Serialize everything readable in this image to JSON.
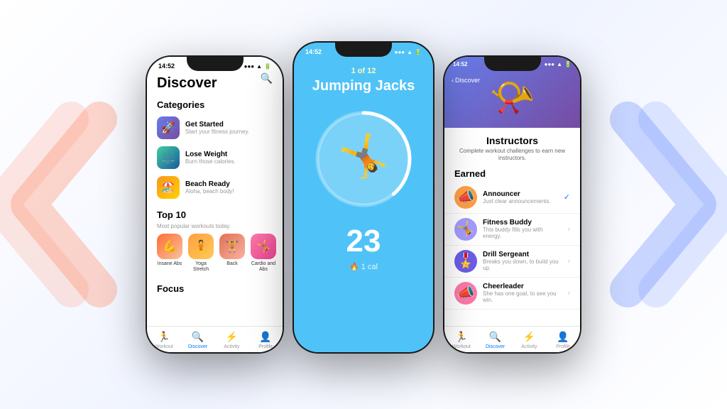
{
  "background": {
    "color": "#f5f5f7"
  },
  "left_phone": {
    "status_bar": {
      "time": "14:52",
      "signal": "●●●",
      "wifi": "wifi",
      "battery": "🔋"
    },
    "title": "Discover",
    "categories_title": "Categories",
    "categories": [
      {
        "icon": "🚀",
        "name": "Get Started",
        "sub": "Start your fitness journey.",
        "style": "rocket"
      },
      {
        "icon": "⚖️",
        "name": "Lose Weight",
        "sub": "Burn those calories.",
        "style": "weight"
      },
      {
        "icon": "🏖️",
        "name": "Beach Ready",
        "sub": "Aloha, beach body!",
        "style": "beach"
      }
    ],
    "top10_title": "Top 10",
    "top10_subtitle": "Most popular workouts today.",
    "workouts": [
      {
        "icon": "💪",
        "label": "Insane Abs"
      },
      {
        "icon": "🧘",
        "label": "Yoga Stretch"
      },
      {
        "icon": "🏋️",
        "label": "Back"
      },
      {
        "icon": "🤸",
        "label": "Cardio and Abs"
      }
    ],
    "focus_title": "Focus",
    "tabs": [
      {
        "icon": "🏃",
        "label": "Workout",
        "active": false
      },
      {
        "icon": "🔍",
        "label": "Discover",
        "active": true
      },
      {
        "icon": "⚡",
        "label": "Activity",
        "active": false
      },
      {
        "icon": "👤",
        "label": "Profile",
        "active": false
      }
    ]
  },
  "center_phone": {
    "status": {
      "left": "14:52",
      "right": "●●● ▲ 🔋"
    },
    "counter": "1 of 12",
    "exercise_name": "Jumping Jacks",
    "number": "23",
    "cal": "1 cal"
  },
  "right_phone": {
    "status_bar": {
      "time": "14:52",
      "icons": "●●● ▲ 🔋"
    },
    "back_label": "Discover",
    "header_emoji": "🎺",
    "title": "Instructors",
    "subtitle": "Complete workout challenges to earn new\ninstructors.",
    "earned_title": "Earned",
    "instructors": [
      {
        "emoji": "📣",
        "name": "Announcer",
        "desc": "Just clear announcements.",
        "action": "check",
        "bg": "#ff9f43"
      },
      {
        "emoji": "🤸",
        "name": "Fitness Buddy",
        "desc": "This buddy fills you with energy.",
        "action": "chevron",
        "bg": "#a29bfe"
      },
      {
        "emoji": "🎖️",
        "name": "Drill Sergeant",
        "desc": "Breaks you down, to build you up.",
        "action": "chevron",
        "bg": "#6c5ce7"
      },
      {
        "emoji": "📣",
        "name": "Cheerleader",
        "desc": "She has one goal, to see you win.",
        "action": "chevron",
        "bg": "#fd79a8"
      }
    ],
    "tabs": [
      {
        "icon": "🏃",
        "label": "Workout",
        "active": false
      },
      {
        "icon": "🔍",
        "label": "Discover",
        "active": true
      },
      {
        "icon": "⚡",
        "label": "Activity",
        "active": false
      },
      {
        "icon": "👤",
        "label": "Profile",
        "active": false
      }
    ]
  }
}
